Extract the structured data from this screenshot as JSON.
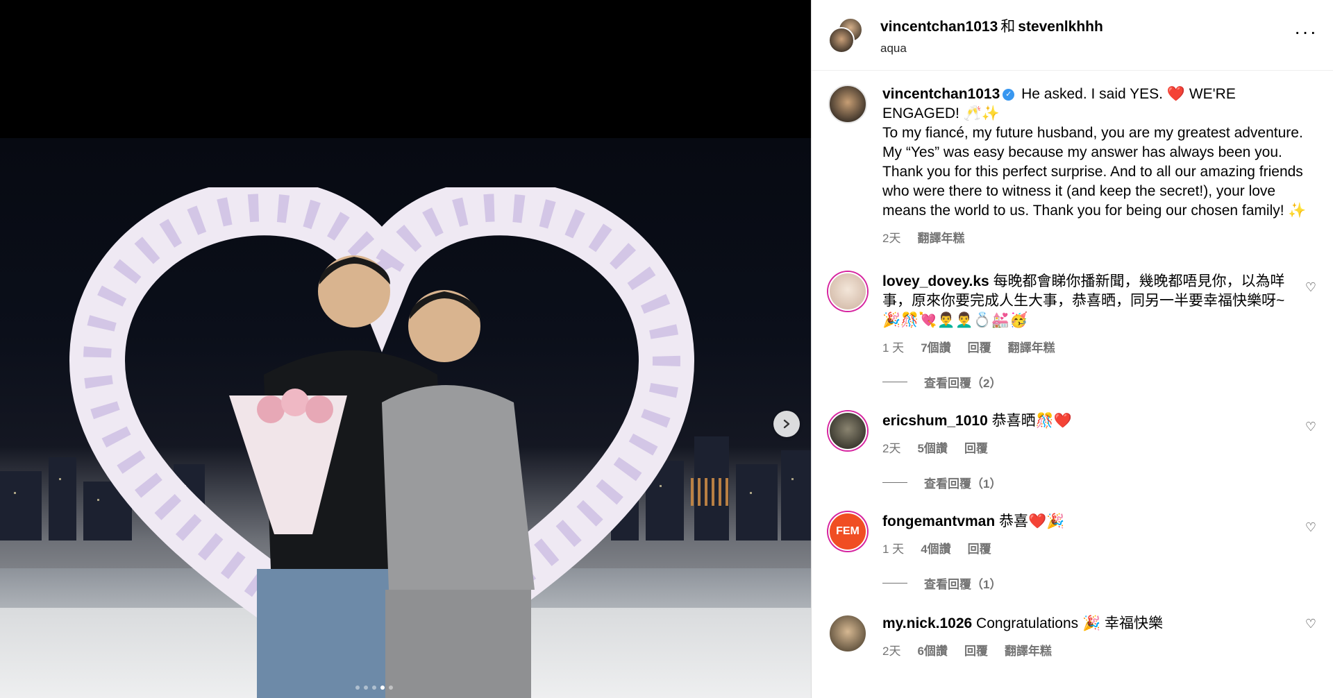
{
  "post_header": {
    "user1": "vincentchan1013",
    "joiner": "和",
    "user2": "stevenlkhhh",
    "audio": "aqua",
    "more_label": "···"
  },
  "caption": {
    "username": "vincentchan1013",
    "verified_mark": "✓",
    "text1": "He asked. I said YES. ❤️ WE'RE ENGAGED! 🥂✨",
    "text2": "To my fiancé, my future husband, you are my greatest adventure. My “Yes” was easy because my answer has always been you. Thank you for this perfect surprise. And to all our amazing friends who were there to witness it (and keep the secret!), your love means the world to us. Thank you for being our chosen family! ✨",
    "time": "2天",
    "translate": "翻譯年糕"
  },
  "comments": [
    {
      "username": "lovey_dovey.ks",
      "text": "每晚都會睇你播新聞，幾晚都唔見你，以為咩事，原來你要完成人生大事，恭喜晒，同另一半要幸福快樂呀~🎉🎊💘👨‍🦱👨‍🦱💍💒🥳",
      "time": "1 天",
      "likes": "7個讚",
      "reply": "回覆",
      "translate": "翻譯年糕",
      "view_replies": "查看回覆（2）"
    },
    {
      "username": "ericshum_1010",
      "text": "恭喜晒🎊❤️",
      "time": "2天",
      "likes": "5個讚",
      "reply": "回覆",
      "translate": "",
      "view_replies": "查看回覆（1）"
    },
    {
      "username": "fongemantvman",
      "text": "恭喜❤️🎉",
      "time": "1 天",
      "likes": "4個讚",
      "reply": "回覆",
      "translate": "",
      "view_replies": "查看回覆（1）",
      "avatar_text": "FEM"
    },
    {
      "username": "my.nick.1026",
      "text": "Congratulations 🎉 幸福快樂",
      "time": "2天",
      "likes": "6個讚",
      "reply": "回覆",
      "translate": "翻譯年糕"
    }
  ],
  "icons": {
    "like": "heart-outline-icon",
    "next": "chevron-right-icon"
  },
  "colors": {
    "link_gray": "#737373",
    "verified_blue": "#3897f0",
    "story_ring": "#d6249f",
    "fem_orange": "#f04e23"
  }
}
